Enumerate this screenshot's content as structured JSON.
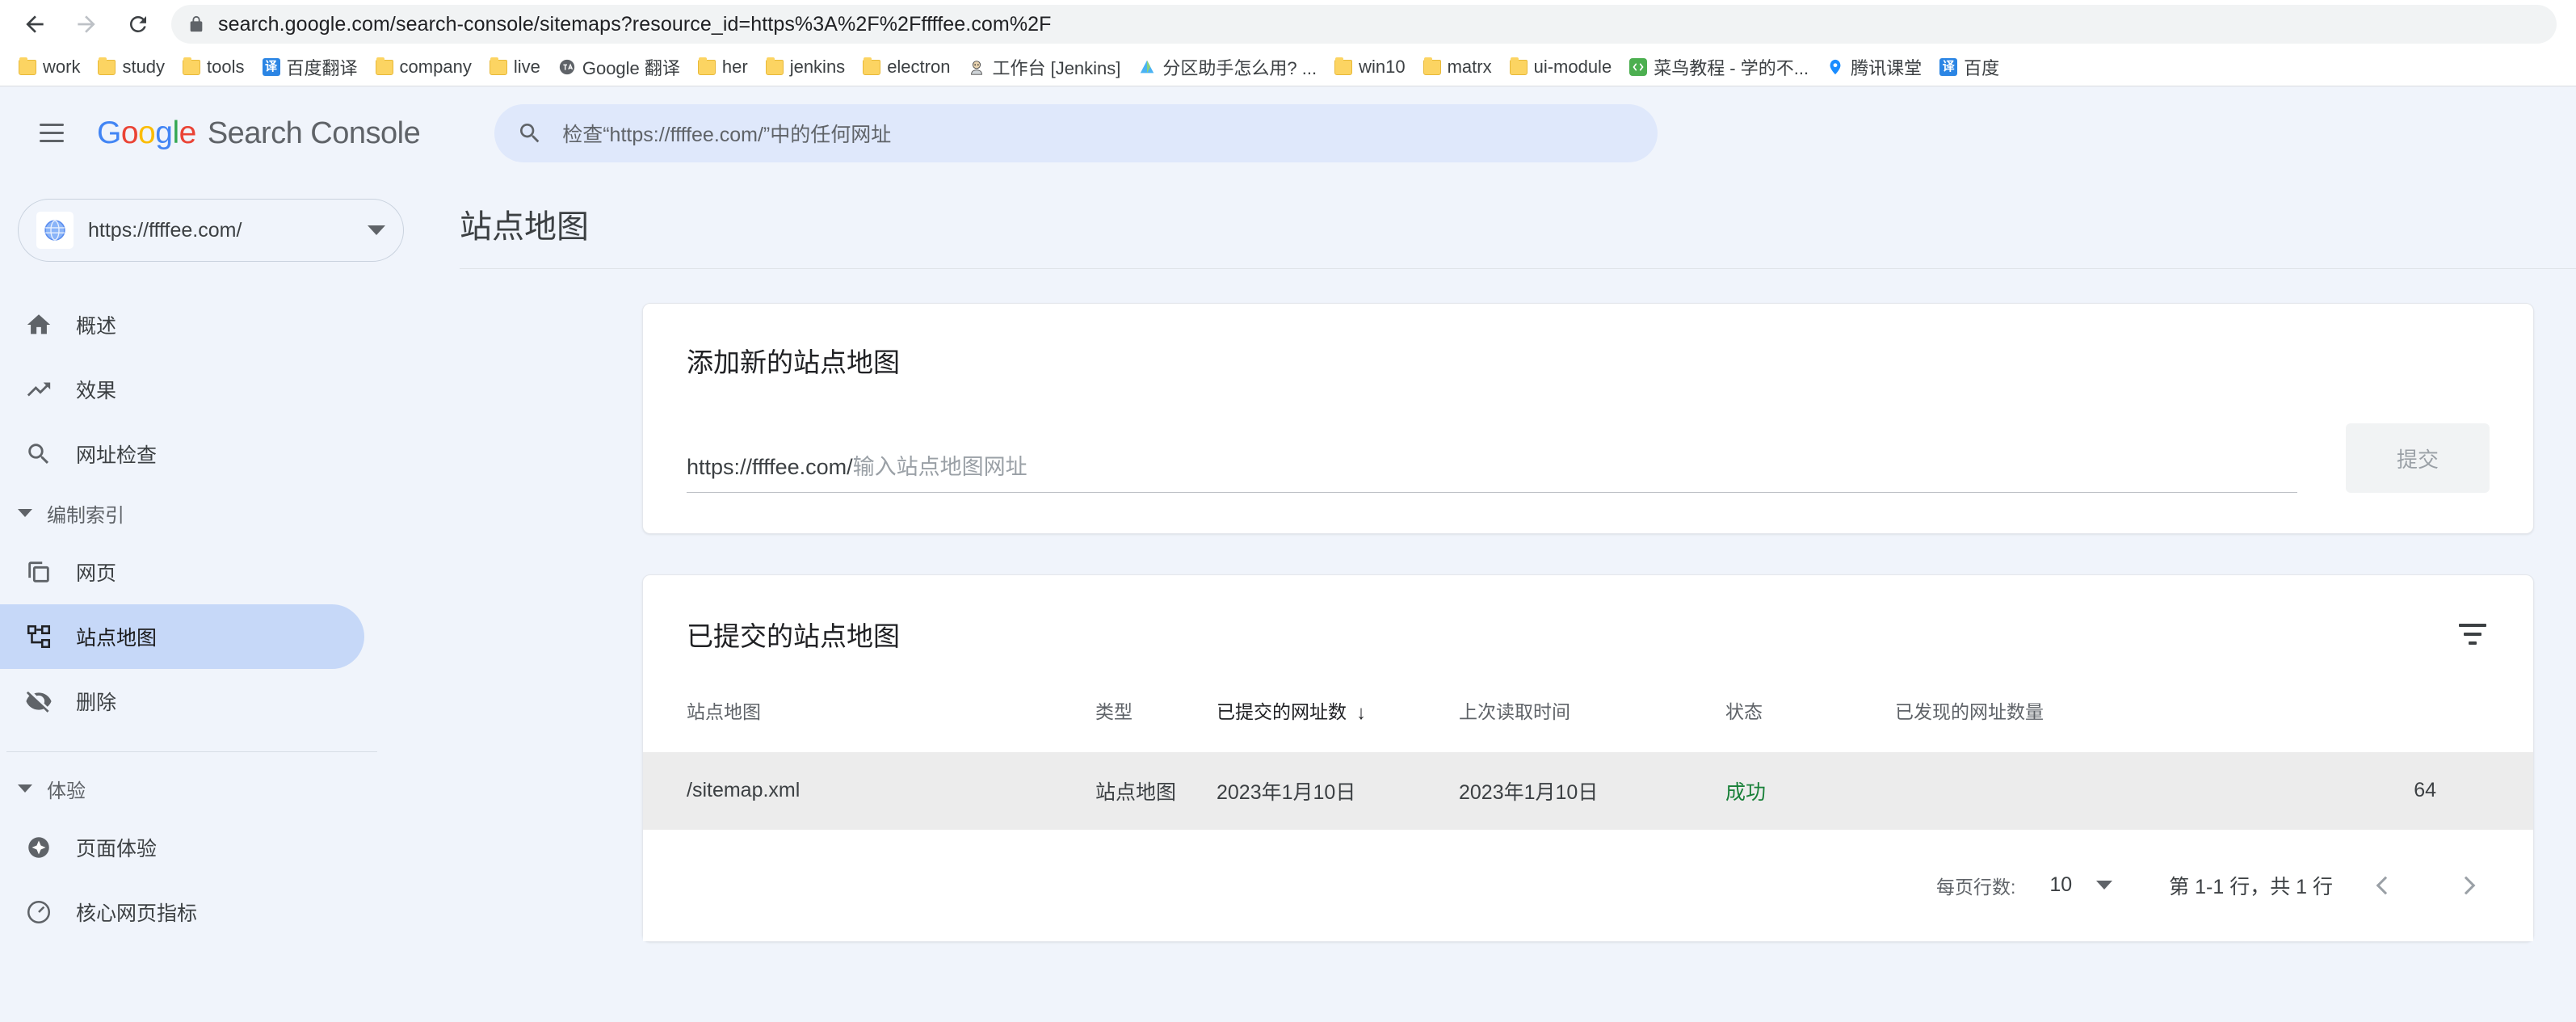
{
  "browser": {
    "back_icon": "back-arrow-icon",
    "forward_icon": "forward-arrow-icon",
    "reload_icon": "reload-icon",
    "lock_icon": "lock-icon",
    "url_prefix": "search.google.com",
    "url_path": "/search-console/sitemaps?resource_id=https%3A%2F%2Fffffee.com%2F",
    "url_full": "search.google.com/search-console/sitemaps?resource_id=https%3A%2F%2Fffffee.com%2F",
    "bookmarks": [
      {
        "label": "work",
        "icon": "folder-icon"
      },
      {
        "label": "study",
        "icon": "folder-icon"
      },
      {
        "label": "tools",
        "icon": "folder-icon"
      },
      {
        "label": "百度翻译",
        "icon": "baidu-translate-icon",
        "glyph": "译"
      },
      {
        "label": "company",
        "icon": "folder-icon"
      },
      {
        "label": "live",
        "icon": "folder-icon"
      },
      {
        "label": "Google 翻译",
        "icon": "google-translate-icon",
        "glyph": "G"
      },
      {
        "label": "her",
        "icon": "folder-icon"
      },
      {
        "label": "jenkins",
        "icon": "folder-icon"
      },
      {
        "label": "electron",
        "icon": "folder-icon"
      },
      {
        "label": "工作台 [Jenkins]",
        "icon": "jenkins-icon",
        "glyph": "J"
      },
      {
        "label": "分区助手怎么用? ...",
        "icon": "partition-assistant-icon",
        "glyph": "A"
      },
      {
        "label": "win10",
        "icon": "folder-icon"
      },
      {
        "label": "matrx",
        "icon": "folder-icon"
      },
      {
        "label": "ui-module",
        "icon": "folder-icon"
      },
      {
        "label": "菜鸟教程 - 学的不...",
        "icon": "runoob-icon",
        "glyph": "R"
      },
      {
        "label": "腾讯课堂",
        "icon": "tencent-ketang-icon",
        "glyph": "T"
      },
      {
        "label": "百度",
        "icon": "baidu-translate-icon",
        "glyph": "译"
      }
    ]
  },
  "header": {
    "menu_icon": "hamburger-menu-icon",
    "brand": {
      "g": "G",
      "o1": "o",
      "o2": "o",
      "g2": "g",
      "l": "l",
      "e": "e",
      "product": "Search Console"
    },
    "search": {
      "icon": "search-icon",
      "placeholder": "检查“https://ffffee.com/”中的任何网址"
    }
  },
  "sidebar": {
    "property": {
      "favicon": "globe-favicon-icon",
      "url": "https://ffffee.com/",
      "caret": "chevron-down-icon"
    },
    "top_items": [
      {
        "label": "概述",
        "icon": "home-icon"
      },
      {
        "label": "效果",
        "icon": "trending-up-icon"
      },
      {
        "label": "网址检查",
        "icon": "search-icon"
      }
    ],
    "group_indexing": {
      "label": "编制索引",
      "caret": "caret-down-icon",
      "items": [
        {
          "label": "网页",
          "icon": "pages-icon",
          "active": false
        },
        {
          "label": "站点地图",
          "icon": "sitemap-icon",
          "active": true
        },
        {
          "label": "删除",
          "icon": "eye-off-icon",
          "active": false
        }
      ]
    },
    "group_experience": {
      "label": "体验",
      "caret": "caret-down-icon",
      "items": [
        {
          "label": "页面体验",
          "icon": "page-experience-icon"
        },
        {
          "label": "核心网页指标",
          "icon": "core-web-vitals-icon"
        }
      ]
    }
  },
  "main": {
    "page_title": "站点地图",
    "add_card": {
      "title": "添加新的站点地图",
      "prefix": "https://ffffee.com/",
      "placeholder": "输入站点地图网址",
      "input_value": "",
      "submit_label": "提交"
    },
    "list_card": {
      "title": "已提交的站点地图",
      "filter_icon": "filter-icon",
      "columns": [
        {
          "key": "sitemap",
          "label": "站点地图",
          "sorted": false
        },
        {
          "key": "type",
          "label": "类型",
          "sorted": false
        },
        {
          "key": "sub",
          "label": "已提交的网址数",
          "sorted": true,
          "sort_arrow": "↓"
        },
        {
          "key": "read",
          "label": "上次读取时间",
          "sorted": false
        },
        {
          "key": "status",
          "label": "状态",
          "sorted": false
        },
        {
          "key": "found",
          "label": "已发现的网址数量",
          "sorted": false
        }
      ],
      "rows": [
        {
          "sitemap": "/sitemap.xml",
          "type": "站点地图",
          "sub": "2023年1月10日",
          "read": "2023年1月10日",
          "status": "成功",
          "status_color": "#188038",
          "found": "64"
        }
      ],
      "footer": {
        "rows_per_page_label": "每页行数:",
        "rows_per_page_value": "10",
        "rows_caret": "caret-down-icon",
        "range_label": "第 1-1 行，共 1 行",
        "prev_icon": "chevron-left-icon",
        "next_icon": "chevron-right-icon"
      }
    }
  },
  "colors": {
    "app_bg": "#f0f4fb",
    "card_bg": "#ffffff",
    "active_nav": "#c6d8f8",
    "search_bg": "#dfe8fb",
    "success": "#188038",
    "row_bg": "#ececec"
  }
}
